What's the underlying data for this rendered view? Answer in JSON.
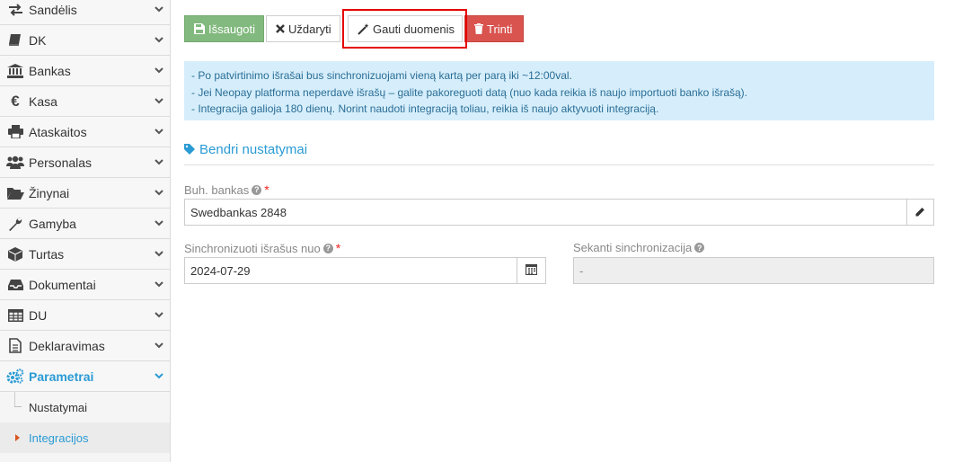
{
  "sidebar": {
    "items": [
      {
        "label": "Sandėlis",
        "icon": "exchange-icon"
      },
      {
        "label": "DK",
        "icon": "book-icon"
      },
      {
        "label": "Bankas",
        "icon": "bank-icon"
      },
      {
        "label": "Kasa",
        "icon": "euro-icon"
      },
      {
        "label": "Ataskaitos",
        "icon": "print-icon"
      },
      {
        "label": "Personalas",
        "icon": "users-icon"
      },
      {
        "label": "Žinynai",
        "icon": "folder-open-icon"
      },
      {
        "label": "Gamyba",
        "icon": "wrench-icon"
      },
      {
        "label": "Turtas",
        "icon": "cube-icon"
      },
      {
        "label": "Dokumentai",
        "icon": "inbox-icon"
      },
      {
        "label": "DU",
        "icon": "table-icon"
      },
      {
        "label": "Deklaravimas",
        "icon": "file-text-icon"
      },
      {
        "label": "Parametrai",
        "icon": "cogs-icon"
      }
    ],
    "subitems": [
      {
        "label": "Nustatymai"
      },
      {
        "label": "Integracijos"
      }
    ]
  },
  "toolbar": {
    "save_label": "Išsaugoti",
    "close_label": "Uždaryti",
    "fetch_label": "Gauti duomenis",
    "delete_label": "Trinti"
  },
  "info": {
    "lines": [
      "- Po patvirtinimo išrašai bus sinchronizuojami vieną kartą per parą iki ~12:00val.",
      "- Jei Neopay platforma neperdavė išrašų – galite pakoreguoti datą (nuo kada reikia iš naujo importuoti banko išrašą).",
      "- Integracija galioja 180 dienų. Norint naudoti integraciją toliau, reikia iš naujo aktyvuoti integraciją."
    ]
  },
  "section": {
    "title": "Bendri nustatymai"
  },
  "form": {
    "bank_label": "Buh. bankas",
    "bank_value": "Swedbankas 2848",
    "sync_from_label": "Sinchronizuoti išrašus nuo",
    "sync_from_value": "2024-07-29",
    "next_sync_label": "Sekanti sinchronizacija",
    "next_sync_value": "-",
    "required_mark": "*",
    "help_mark": "?"
  },
  "colors": {
    "accent": "#2a9bd4",
    "save": "#82b97e",
    "delete": "#d9534f",
    "info_bg": "#d6eefb",
    "highlight": "#e60000"
  }
}
